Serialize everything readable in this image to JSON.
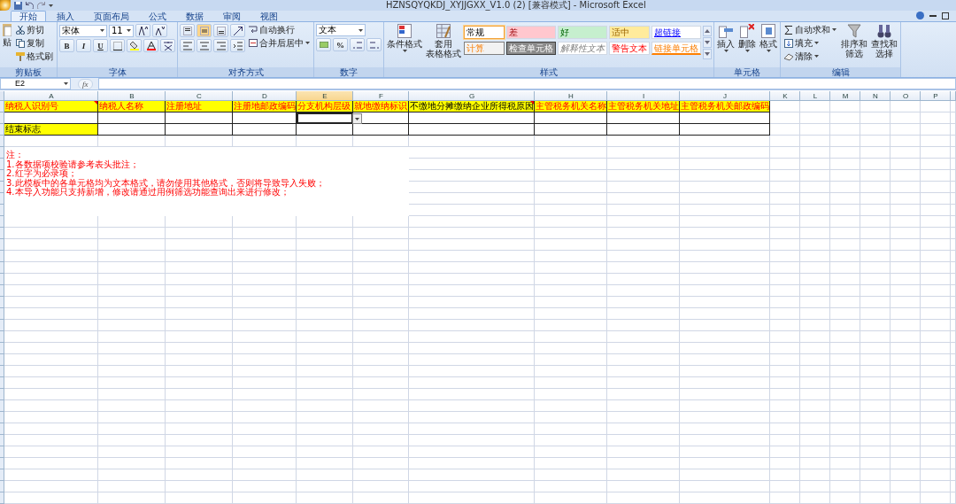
{
  "window": {
    "title": "HZNSQYQKDJ_XYJJGXX_V1.0 (2)  [兼容模式] - Microsoft Excel"
  },
  "tabs": [
    {
      "label": "开始",
      "selected": true
    },
    {
      "label": "插入",
      "selected": false
    },
    {
      "label": "页面布局",
      "selected": false
    },
    {
      "label": "公式",
      "selected": false
    },
    {
      "label": "数据",
      "selected": false
    },
    {
      "label": "审阅",
      "selected": false
    },
    {
      "label": "视图",
      "selected": false
    }
  ],
  "ribbon": [
    {
      "kind": "clipboard",
      "label": "剪贴板",
      "paste": "贴",
      "buttons": [
        "剪切",
        "复制",
        "格式刷"
      ]
    },
    {
      "kind": "font",
      "label": "字体",
      "font": "宋体",
      "size": "11",
      "styles": [
        "B",
        "I",
        "U"
      ]
    },
    {
      "kind": "alignment",
      "label": "对齐方式",
      "wrap": "自动换行",
      "merge": "合并后居中"
    },
    {
      "kind": "number",
      "label": "数字",
      "format": "文本",
      "percent": "%"
    },
    {
      "kind": "styles",
      "label": "样式",
      "conditional": [
        "条件格式"
      ],
      "table": [
        "套用",
        "表格格式"
      ],
      "cells": [
        {
          "text": "常规",
          "kind": "normal",
          "selected": true
        },
        {
          "text": "差",
          "kind": "bad",
          "selected": false
        },
        {
          "text": "好",
          "kind": "good",
          "selected": false
        },
        {
          "text": "适中",
          "kind": "neutral",
          "selected": false
        },
        {
          "text": "超链接",
          "kind": "hyperlink",
          "selected": false
        },
        {
          "text": "计算",
          "kind": "calculation",
          "selected": false
        },
        {
          "text": "检查单元格",
          "kind": "check",
          "selected": false
        },
        {
          "text": "解释性文本",
          "kind": "explanatory",
          "selected": false
        },
        {
          "text": "警告文本",
          "kind": "warning",
          "selected": false
        },
        {
          "text": "链接单元格",
          "kind": "linked",
          "selected": false
        }
      ]
    },
    {
      "kind": "cells",
      "label": "单元格",
      "buttons": [
        "插入",
        "删除",
        "格式"
      ]
    },
    {
      "kind": "editing",
      "label": "编辑",
      "small": [
        "自动求和",
        "填充",
        "清除"
      ],
      "large": [
        [
          "排序和",
          "筛选"
        ],
        [
          "查找和",
          "选择"
        ]
      ]
    }
  ],
  "formula_bar": {
    "name_box": "E2",
    "fx": "fx"
  },
  "columns": [
    {
      "letter": "A",
      "selected": false
    },
    {
      "letter": "B",
      "selected": false
    },
    {
      "letter": "C",
      "selected": false
    },
    {
      "letter": "D",
      "selected": false
    },
    {
      "letter": "E",
      "selected": true
    },
    {
      "letter": "F",
      "selected": false
    },
    {
      "letter": "G",
      "selected": false
    },
    {
      "letter": "H",
      "selected": false
    },
    {
      "letter": "I",
      "selected": false
    },
    {
      "letter": "J",
      "selected": false
    },
    {
      "letter": "K",
      "selected": false
    },
    {
      "letter": "L",
      "selected": false
    },
    {
      "letter": "M",
      "selected": false
    },
    {
      "letter": "N",
      "selected": false
    },
    {
      "letter": "O",
      "selected": false
    },
    {
      "letter": "P",
      "selected": false
    }
  ],
  "rows": [
    [
      {
        "text": "纳税人识别号",
        "kind": "required",
        "comment": true,
        "selected": false
      },
      {
        "text": "纳税人名称",
        "kind": "required",
        "comment": false,
        "selected": false
      },
      {
        "text": "注册地址",
        "kind": "required",
        "comment": false,
        "selected": false
      },
      {
        "text": "注册地邮政编码",
        "kind": "required",
        "comment": false,
        "selected": false
      },
      {
        "text": "分支机构层级",
        "kind": "required",
        "comment": false,
        "selected": false
      },
      {
        "text": "就地缴纳标识",
        "kind": "required",
        "comment": false,
        "selected": false
      },
      {
        "text": "不缴地分摊缴纳企业所得税原因",
        "kind": "optional",
        "comment": true,
        "selected": false
      },
      {
        "text": "主管税务机关名称",
        "kind": "required",
        "comment": false,
        "selected": false
      },
      {
        "text": "主管税务机关地址",
        "kind": "required",
        "comment": false,
        "selected": false
      },
      {
        "text": "主管税务机关邮政编码",
        "kind": "required",
        "comment": false,
        "selected": false
      }
    ],
    [
      {
        "kind": "blank",
        "selected": false
      },
      {
        "kind": "blank",
        "selected": false
      },
      {
        "kind": "blank",
        "selected": false
      },
      {
        "kind": "blank",
        "selected": false
      },
      {
        "kind": "blank",
        "selected": true
      },
      {
        "kind": "blank",
        "selected": false
      },
      {
        "kind": "blank",
        "selected": false
      },
      {
        "kind": "blank",
        "selected": false
      },
      {
        "kind": "blank",
        "selected": false
      },
      {
        "kind": "blank",
        "selected": false
      }
    ],
    [
      {
        "text": "结束标志",
        "kind": "marker",
        "selected": false
      },
      {
        "kind": "blank",
        "selected": false
      },
      {
        "kind": "blank",
        "selected": false
      },
      {
        "kind": "blank",
        "selected": false
      },
      {
        "kind": "blank",
        "selected": false
      },
      {
        "kind": "blank",
        "selected": false
      },
      {
        "kind": "blank",
        "selected": false
      },
      {
        "kind": "blank",
        "selected": false
      },
      {
        "kind": "blank",
        "selected": false
      },
      {
        "kind": "blank",
        "selected": false
      }
    ]
  ],
  "notes": [
    "注：",
    "1.各数据项校验请参考表头批注；",
    "2.红字为必录项；",
    "3.此模板中的各单元格均为文本格式，请勿使用其他格式，否则将导致导入失败；",
    "4.本导入功能只支持新增，修改请通过用例筛选功能查询出来进行修改；"
  ]
}
